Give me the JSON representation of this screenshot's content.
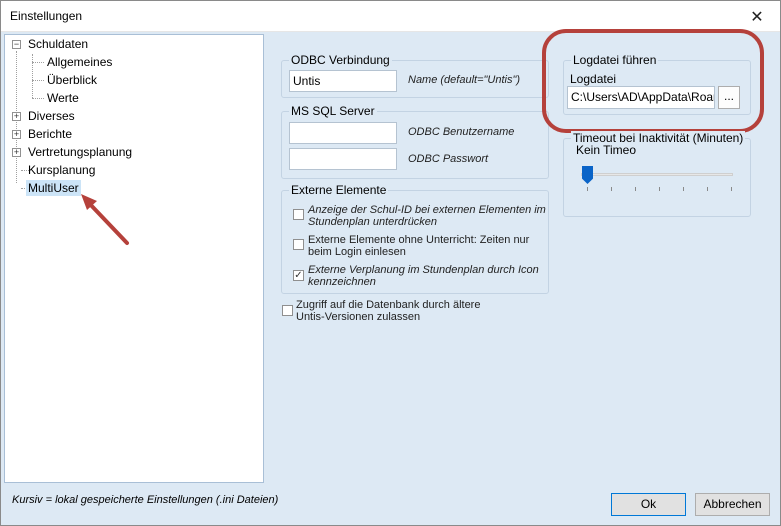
{
  "window": {
    "title": "Einstellungen",
    "close_glyph": "✕"
  },
  "tree": {
    "items": [
      {
        "label": "Schuldaten",
        "expander": "−"
      },
      {
        "label": "Allgemeines"
      },
      {
        "label": "Überblick"
      },
      {
        "label": "Werte"
      },
      {
        "label": "Diverses",
        "expander": "+"
      },
      {
        "label": "Berichte",
        "expander": "+"
      },
      {
        "label": "Vertretungsplanung",
        "expander": "+"
      },
      {
        "label": "Kursplanung"
      },
      {
        "label": "MultiUser",
        "selected": true
      }
    ]
  },
  "odbc": {
    "group_title": "ODBC Verbindung",
    "name_value": "Untis",
    "name_hint": "Name (default=\"Untis\")"
  },
  "mssql": {
    "group_title": "MS SQL Server",
    "user_value": "",
    "user_hint": "ODBC Benutzername",
    "password_value": "",
    "password_hint": "ODBC Passwort"
  },
  "externe": {
    "group_title": "Externe Elemente",
    "checks": [
      {
        "label_line1": "Anzeige der Schul-ID bei externen Elementen im",
        "label_line2": "Stundenplan unterdrücken",
        "checked": false,
        "italic": true,
        "mark": ""
      },
      {
        "label_line1": "Externe Elemente ohne Unterricht: Zeiten nur",
        "label_line2": "beim Login einlesen",
        "checked": false,
        "italic": false,
        "mark": ""
      },
      {
        "label_line1": "Externe Verplanung im Stundenplan durch Icon",
        "label_line2": "kennzeichnen",
        "checked": true,
        "italic": true,
        "mark": "✓"
      }
    ]
  },
  "legacy_access": {
    "label_line1": "Zugriff auf die Datenbank durch ältere",
    "label_line2": "Untis-Versionen zulassen",
    "checked": false,
    "mark": ""
  },
  "logdatei": {
    "group_title": "Logdatei führen",
    "field_label": "Logdatei",
    "path_value": "C:\\Users\\AD\\AppData\\Roam",
    "browse_label": "..."
  },
  "timeout": {
    "group_title": "Timeout bei Inaktivität (Minuten)",
    "value_label": "Kein Timeo",
    "slider_level": 0
  },
  "footer": {
    "note": "Kursiv = lokal gespeicherte Einstellungen (.ini Dateien)",
    "ok_label": "Ok",
    "cancel_label": "Abbrechen"
  },
  "colors": {
    "dialog_bg": "#dde9f4",
    "annotation_red": "#b5413b",
    "selection": "#cce4f7",
    "slider_thumb": "#0a64c8"
  }
}
